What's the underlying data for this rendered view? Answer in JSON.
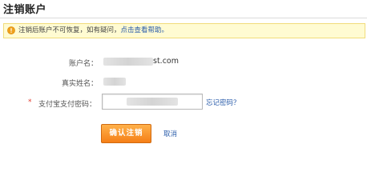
{
  "page": {
    "title": "注销账户"
  },
  "notice": {
    "text": "注销后账户不可恢复，如有疑问，",
    "link": "点击查看帮助。",
    "icon": "warning-icon",
    "colors": {
      "background": "#fffbd2",
      "border": "#f1dc7a",
      "link": "#2a5caa"
    }
  },
  "form": {
    "account_label": "账户名：",
    "account_value_suffix": "st.com",
    "realname_label": "真实姓名：",
    "password_label": "支付宝支付密码：",
    "required_mark": "*",
    "forgot_link": "忘记密码？",
    "submit_label": "确认注销",
    "cancel_label": "取消",
    "colors": {
      "button": "#f57f17",
      "link": "#2a5caa",
      "required": "#e23b2e"
    }
  }
}
